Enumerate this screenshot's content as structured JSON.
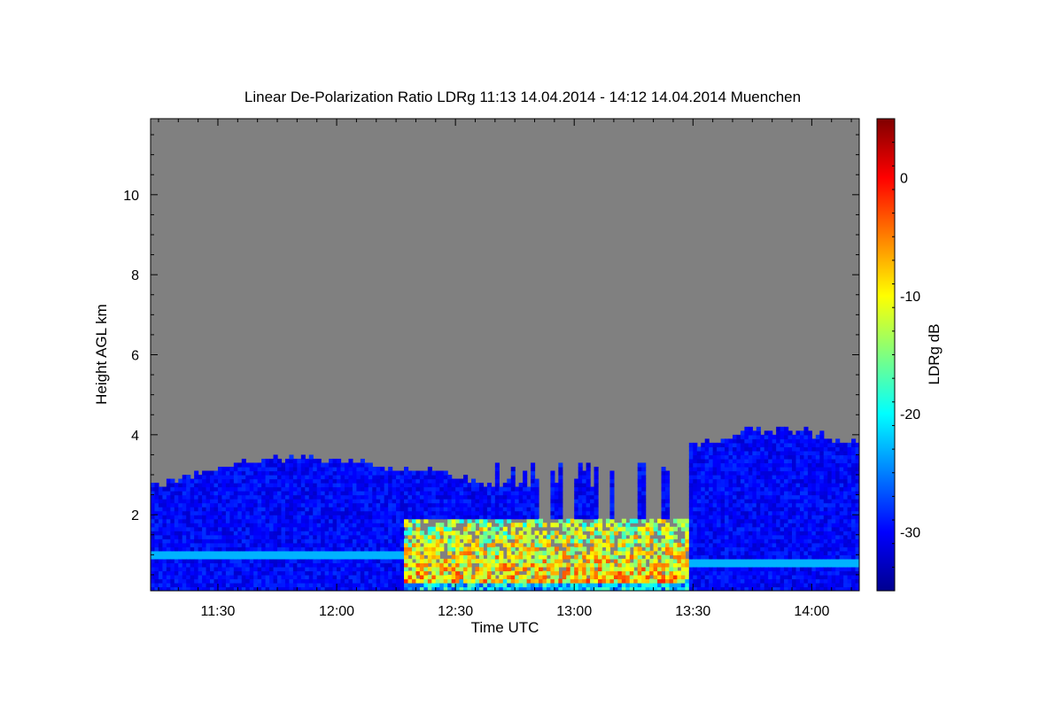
{
  "chart_data": {
    "type": "heatmap",
    "title": "Linear De-Polarization Ratio LDRg   11:13 14.04.2014 - 14:12 14.04.2014 Muenchen",
    "xlabel": "Time UTC",
    "ylabel": "Height AGL km",
    "x_unit": "minutes of day (UTC)",
    "xlim": [
      673,
      732
    ],
    "x_ticks": [
      {
        "value": 690,
        "label": "11:30"
      },
      {
        "value": 720,
        "label": "12:00"
      },
      {
        "value": 750,
        "label": "12:30"
      },
      {
        "value": 780,
        "label": "13:00"
      },
      {
        "value": 810,
        "label": "13:30"
      },
      {
        "value": 840,
        "label": "14:00"
      }
    ],
    "ylim": [
      0.1,
      11.9
    ],
    "y_ticks": [
      {
        "value": 2,
        "label": "2"
      },
      {
        "value": 4,
        "label": "4"
      },
      {
        "value": 6,
        "label": "6"
      },
      {
        "value": 8,
        "label": "8"
      },
      {
        "value": 10,
        "label": "10"
      }
    ],
    "colorbar": {
      "label": "LDRg dB",
      "range": [
        -35,
        5
      ],
      "colormap": "jet",
      "ticks": [
        {
          "value": 0,
          "label": "0"
        },
        {
          "value": -10,
          "label": "-10"
        },
        {
          "value": -20,
          "label": "-20"
        },
        {
          "value": -30,
          "label": "-30"
        }
      ]
    },
    "background_color": "#808080",
    "features": [
      {
        "name": "cloud-layer-early",
        "t_start": 673,
        "t_end": 790,
        "top_km": [
          2.6,
          3.3,
          2.6
        ],
        "base_km": 0.25,
        "ldr_db": -31
      },
      {
        "name": "cloud-layer-late",
        "t_start": 809,
        "t_end": 852,
        "top_km": [
          3.4,
          3.9,
          3.3
        ],
        "base_km": 0.25,
        "ldr_db": -29
      },
      {
        "name": "bright-band-early",
        "t_start": 673,
        "t_end": 735,
        "height_km": 0.95,
        "ldr_db": -25
      },
      {
        "name": "bright-band-late",
        "t_start": 810,
        "t_end": 850,
        "height_km": 0.75,
        "ldr_db": -22
      },
      {
        "name": "insect-clutter",
        "t_start": 737,
        "t_end": 809,
        "base_km": 0.25,
        "top_km": 1.9,
        "ldr_db": [
          -20,
          3
        ]
      }
    ]
  }
}
